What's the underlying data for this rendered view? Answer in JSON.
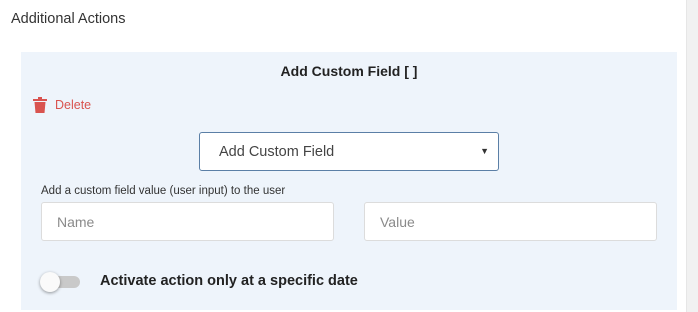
{
  "section": {
    "title": "Additional Actions"
  },
  "panel": {
    "title": "Add Custom Field [ ]",
    "delete_label": "Delete",
    "action_select": {
      "value": "Add Custom Field"
    },
    "description": "Add a custom field value (user input) to the user",
    "name_input": {
      "placeholder": "Name"
    },
    "value_input": {
      "placeholder": "Value"
    },
    "date_toggle": {
      "label": "Activate action only at a specific date",
      "enabled": false
    }
  },
  "colors": {
    "panel_bg": "#eef4fb",
    "delete_red": "#d9534f",
    "select_border": "#5b7fa6"
  },
  "icons": {
    "delete": "trash-icon",
    "select_caret": "caret-down-icon"
  }
}
